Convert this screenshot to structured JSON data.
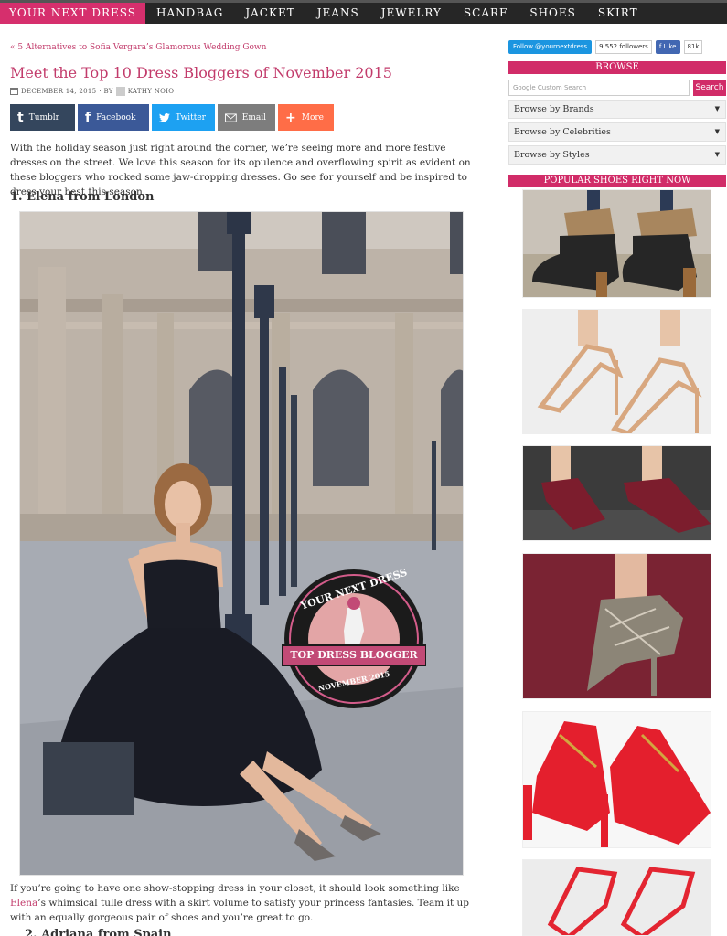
{
  "nav": {
    "brand": "YOUR NEXT DRESS",
    "items": [
      "HANDBAG",
      "JACKET",
      "JEANS",
      "JEWELRY",
      "SCARF",
      "SHOES",
      "SKIRT"
    ]
  },
  "post": {
    "prev_link": "« 5 Alternatives to Sofia Vergara’s Glamorous Wedding Gown",
    "title": "Meet the Top 10 Dress Bloggers of November 2015",
    "date": "DECEMBER 14, 2015",
    "by": "· BY",
    "author": "KATHY NOIO",
    "intro": "With the holiday season just right around the corner, we’re seeing more and more festive dresses on the street. We love this season for its opulence and overflowing spirit as evident on these bloggers who rocked some jaw-dropping dresses. Go see for yourself and be inspired to dress your best this season.",
    "section1": "1. Elena from London",
    "caption_before": "If you’re going to have one show-stopping dress in your closet, it should look something like ",
    "caption_link": "Elena",
    "caption_after": "’s whimsical tulle dress with a skirt volume to satisfy your princess fantasies. Team it up with an equally gorgeous pair of shoes and you’re great to go.",
    "section2": "2. Adriana from Spain"
  },
  "share": {
    "tumblr": "Tumblr",
    "facebook": "Facebook",
    "twitter": "Twitter",
    "email": "Email",
    "more": "More"
  },
  "badge": {
    "top_text": "YOUR NEXT DRESS",
    "ribbon": "TOP DRESS BLOGGER",
    "bottom_text": "NOVEMBER 2015"
  },
  "sidebar": {
    "twitter_follow": "Follow @yournextdress",
    "followers": "9,552 followers",
    "fb_like": "Like",
    "fb_count": "81k",
    "browse_heading": "BROWSE",
    "search_placeholder": "Custom Search",
    "search_brand": "Google",
    "search_button": "Search",
    "dropdowns": [
      "Browse by Brands",
      "Browse by Celebrities",
      "Browse by Styles"
    ],
    "popular_heading": "POPULAR SHOES RIGHT NOW"
  },
  "colors": {
    "accent": "#d12c68",
    "nav_bg": "#262626"
  }
}
